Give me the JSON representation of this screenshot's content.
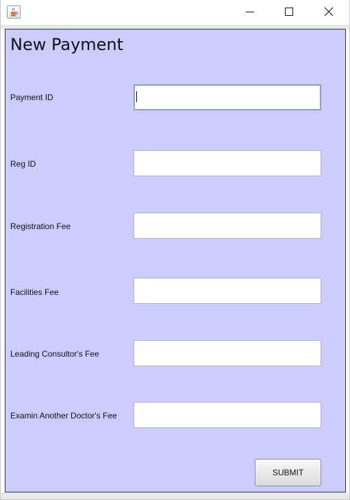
{
  "window": {
    "title": "",
    "icon": "java-cup-icon"
  },
  "titlebar_buttons": {
    "minimize": "minimize-icon",
    "maximize": "maximize-icon",
    "close": "close-icon"
  },
  "form": {
    "title": "New Payment",
    "fields": [
      {
        "label": "Payment ID",
        "value": "",
        "focused": true
      },
      {
        "label": "Reg ID",
        "value": ""
      },
      {
        "label": "Registration Fee",
        "value": ""
      },
      {
        "label": "Facilities Fee",
        "value": ""
      },
      {
        "label": "Leading Consultor's Fee",
        "value": ""
      },
      {
        "label": "Examin Another Doctor's Fee",
        "value": ""
      }
    ],
    "submit_label": "SUBMIT"
  },
  "colors": {
    "panel_background": "#ccccff",
    "input_background": "#ffffff",
    "focus_border": "#8aa3c8"
  }
}
